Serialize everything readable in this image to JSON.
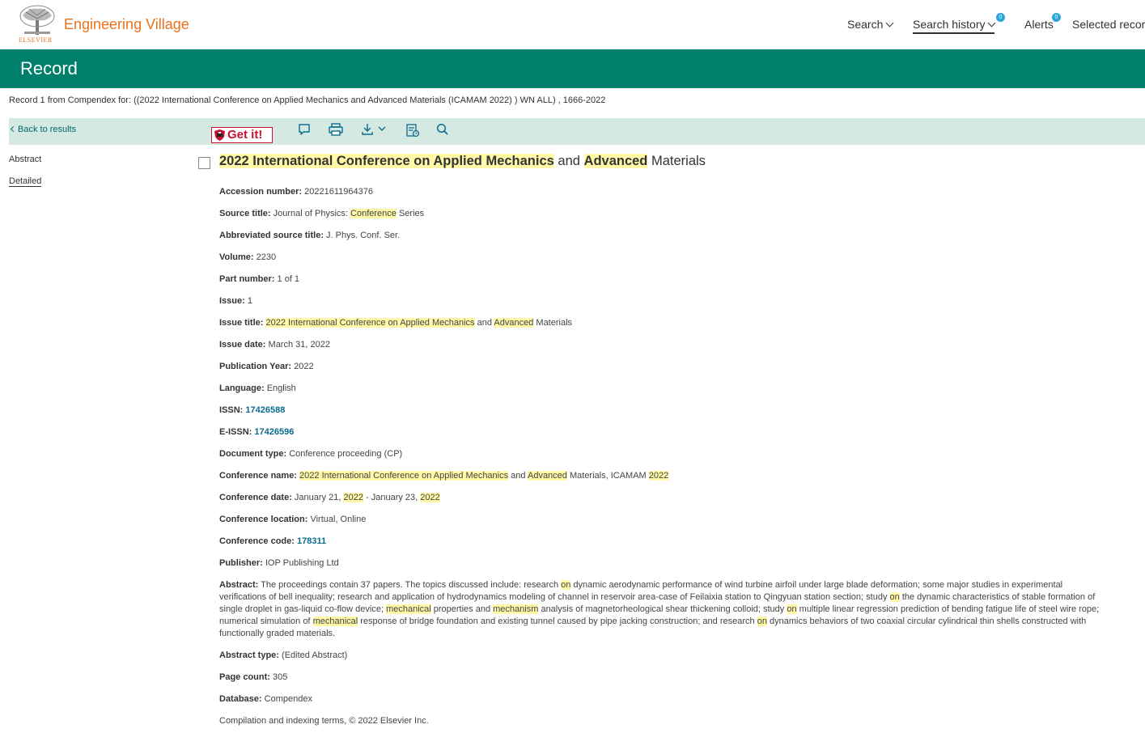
{
  "header": {
    "brand": "Engineering Village",
    "logo_word": "ELSEVIER",
    "nav": {
      "search": "Search",
      "search_history": "Search history",
      "search_history_badge": "0",
      "alerts": "Alerts",
      "alerts_badge": "0",
      "selected_records": "Selected records"
    }
  },
  "band": {
    "title": "Record"
  },
  "record_line": "Record 1 from Compendex for: ((2022 International Conference on Applied Mechanics and Advanced Materials  (ICAMAM 2022)  ) WN ALL) , 1666-2022",
  "toolbar": {
    "back": "Back to results",
    "getit": "Get it!",
    "icons": [
      "comment-icon",
      "print-icon",
      "download-icon",
      "save-to-folder-icon",
      "search-icon"
    ]
  },
  "sidebar": {
    "abstract": "Abstract",
    "detailed": "Detailed"
  },
  "record": {
    "title_parts": [
      "2022 International Conference on Applied Mechanics",
      " and ",
      "Advanced",
      " Materials"
    ],
    "accession": {
      "label": "Accession number:",
      "value": "20221611964376"
    },
    "source_title": {
      "label": "Source title:",
      "pre": "Journal of Physics: ",
      "hl": "Conference",
      "post": " Series"
    },
    "abbrev": {
      "label": "Abbreviated source title:",
      "value": "J. Phys. Conf. Ser."
    },
    "volume": {
      "label": "Volume:",
      "value": "2230"
    },
    "part": {
      "label": "Part number:",
      "value": "1 of 1"
    },
    "issue": {
      "label": "Issue:",
      "value": "1"
    },
    "issue_title": {
      "label": "Issue title:",
      "hl1": "2022 International Conference on Applied Mechanics",
      "mid": " and ",
      "hl2": "Advanced",
      "post": " Materials"
    },
    "issue_date": {
      "label": "Issue date:",
      "value": "March 31, 2022"
    },
    "pub_year": {
      "label": "Publication Year:",
      "value": "2022"
    },
    "language": {
      "label": "Language:",
      "value": "English"
    },
    "issn": {
      "label": "ISSN:",
      "value": "17426588"
    },
    "eissn": {
      "label": "E-ISSN:",
      "value": "17426596"
    },
    "doc_type": {
      "label": "Document type:",
      "value": "Conference proceeding (CP)"
    },
    "conf_name": {
      "label": "Conference name:",
      "hl1": "2022 International Conference on Applied Mechanics",
      "mid": " and ",
      "hl2": "Advanced",
      "mid2": " Materials, ICAMAM ",
      "hl3": "2022"
    },
    "conf_date": {
      "label": "Conference date:",
      "pre": "January 21, ",
      "hl1": "2022",
      "mid": " - January 23, ",
      "hl2": "2022"
    },
    "conf_location": {
      "label": "Conference location:",
      "value": "Virtual, Online"
    },
    "conf_code": {
      "label": "Conference code:",
      "value": "178311"
    },
    "publisher": {
      "label": "Publisher:",
      "value": "IOP Publishing Ltd"
    },
    "abstract": {
      "label": "Abstract:",
      "t1": "The proceedings contain 37 papers. The topics discussed include: research ",
      "h1": "on",
      "t2": " dynamic aerodynamic performance of wind turbine airfoil under large blade deformation; some major studies in experimental verifications of bell inequality; research and application of hydrodynamics modeling of channel in reservoir area-case of Feilaixia station to Qingyuan station section; study ",
      "h2": "on",
      "t3": " the dynamic characteristics of stable formation of single droplet in gas-liquid co-flow device; ",
      "h3": "mechanical",
      "t4": " properties and ",
      "h4": "mechanism",
      "t5": " analysis of magnetorheological shear thickening colloid; study ",
      "h5": "on",
      "t6": " multiple linear regression prediction of bending fatigue life of steel wire rope; numerical simulation of ",
      "h6": "mechanical",
      "t7": " response of bridge foundation and existing tunnel caused by pipe jacking construction; and research ",
      "h7": "on",
      "t8": " dynamics behaviors of two coaxial circular cylindrical thin shells constructed with functionally graded materials."
    },
    "abstract_type": {
      "label": "Abstract type:",
      "value": "(Edited Abstract)"
    },
    "page_count": {
      "label": "Page count:",
      "value": "305"
    },
    "database": {
      "label": "Database:",
      "value": "Compendex"
    },
    "copyright": "Compilation and indexing terms, © 2022 Elsevier Inc."
  },
  "colors": {
    "brand_orange": "#e9711c",
    "band_green": "#007f6a",
    "toolbar_bg": "#d5e9e3",
    "highlight": "#fff8a8",
    "link": "#0b6b8f",
    "getit_red": "#c8102e"
  }
}
